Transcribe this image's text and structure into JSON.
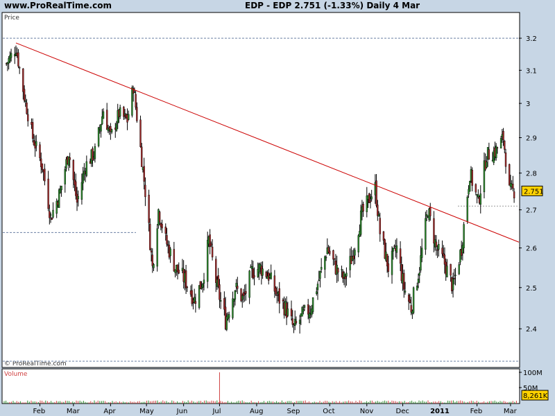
{
  "header": {
    "site": "www.ProRealTime.com",
    "info": "EDP - EDP    2.751 (-1.33%)    Daily  4 Mar"
  },
  "chart_data": [
    {
      "type": "candlestick",
      "title": "EDP - EDP",
      "panel_label": "Price",
      "watermark": "© ProRealTime.com",
      "last_value": "2.751",
      "change": "-1.33%",
      "period": "Daily",
      "date": "4 Mar",
      "y_ticks": [
        "3.2",
        "3.1",
        "3",
        "2.9",
        "2.8",
        "2.7",
        "2.6",
        "2.5",
        "2.4"
      ],
      "ylim": [
        2.34,
        3.25
      ],
      "y_scale": "log",
      "x_labels": [
        "Feb",
        "Mar",
        "Apr",
        "May",
        "Jun",
        "Jul",
        "Aug",
        "Sep",
        "Oct",
        "Nov",
        "Dec",
        "2011",
        "Feb",
        "Mar"
      ],
      "series_close_approx": [
        {
          "x": "2010-01-04",
          "y": 3.12
        },
        {
          "x": "2010-01-12",
          "y": 3.17
        },
        {
          "x": "2010-01-19",
          "y": 3.02
        },
        {
          "x": "2010-01-26",
          "y": 2.9
        },
        {
          "x": "2010-02-03",
          "y": 2.82
        },
        {
          "x": "2010-02-10",
          "y": 2.68
        },
        {
          "x": "2010-02-18",
          "y": 2.75
        },
        {
          "x": "2010-02-25",
          "y": 2.86
        },
        {
          "x": "2010-03-04",
          "y": 2.72
        },
        {
          "x": "2010-03-11",
          "y": 2.82
        },
        {
          "x": "2010-03-19",
          "y": 2.86
        },
        {
          "x": "2010-03-26",
          "y": 2.98
        },
        {
          "x": "2010-04-01",
          "y": 2.9
        },
        {
          "x": "2010-04-08",
          "y": 2.97
        },
        {
          "x": "2010-04-15",
          "y": 2.95
        },
        {
          "x": "2010-04-20",
          "y": 3.05
        },
        {
          "x": "2010-04-23",
          "y": 2.96
        },
        {
          "x": "2010-04-30",
          "y": 2.75
        },
        {
          "x": "2010-05-06",
          "y": 2.55
        },
        {
          "x": "2010-05-11",
          "y": 2.7
        },
        {
          "x": "2010-05-17",
          "y": 2.62
        },
        {
          "x": "2010-05-25",
          "y": 2.55
        },
        {
          "x": "2010-06-02",
          "y": 2.52
        },
        {
          "x": "2010-06-10",
          "y": 2.47
        },
        {
          "x": "2010-06-17",
          "y": 2.52
        },
        {
          "x": "2010-06-22",
          "y": 2.62
        },
        {
          "x": "2010-06-29",
          "y": 2.5
        },
        {
          "x": "2010-07-06",
          "y": 2.42
        },
        {
          "x": "2010-07-14",
          "y": 2.5
        },
        {
          "x": "2010-07-21",
          "y": 2.47
        },
        {
          "x": "2010-07-28",
          "y": 2.54
        },
        {
          "x": "2010-08-04",
          "y": 2.55
        },
        {
          "x": "2010-08-11",
          "y": 2.53
        },
        {
          "x": "2010-08-18",
          "y": 2.48
        },
        {
          "x": "2010-08-25",
          "y": 2.45
        },
        {
          "x": "2010-09-01",
          "y": 2.4
        },
        {
          "x": "2010-09-08",
          "y": 2.43
        },
        {
          "x": "2010-09-15",
          "y": 2.45
        },
        {
          "x": "2010-09-22",
          "y": 2.52
        },
        {
          "x": "2010-09-29",
          "y": 2.6
        },
        {
          "x": "2010-10-06",
          "y": 2.55
        },
        {
          "x": "2010-10-13",
          "y": 2.52
        },
        {
          "x": "2010-10-20",
          "y": 2.58
        },
        {
          "x": "2010-10-27",
          "y": 2.68
        },
        {
          "x": "2010-11-03",
          "y": 2.73
        },
        {
          "x": "2010-11-08",
          "y": 2.76
        },
        {
          "x": "2010-11-12",
          "y": 2.64
        },
        {
          "x": "2010-11-19",
          "y": 2.55
        },
        {
          "x": "2010-11-26",
          "y": 2.6
        },
        {
          "x": "2010-12-02",
          "y": 2.5
        },
        {
          "x": "2010-12-08",
          "y": 2.45
        },
        {
          "x": "2010-12-15",
          "y": 2.55
        },
        {
          "x": "2010-12-22",
          "y": 2.7
        },
        {
          "x": "2010-12-29",
          "y": 2.6
        },
        {
          "x": "2011-01-05",
          "y": 2.56
        },
        {
          "x": "2011-01-12",
          "y": 2.5
        },
        {
          "x": "2011-01-19",
          "y": 2.6
        },
        {
          "x": "2011-01-26",
          "y": 2.8
        },
        {
          "x": "2011-02-02",
          "y": 2.72
        },
        {
          "x": "2011-02-09",
          "y": 2.85
        },
        {
          "x": "2011-02-16",
          "y": 2.86
        },
        {
          "x": "2011-02-23",
          "y": 2.9
        },
        {
          "x": "2011-02-28",
          "y": 2.75
        },
        {
          "x": "2011-03-04",
          "y": 2.751
        }
      ],
      "annotations": [
        {
          "kind": "trendline",
          "color": "#cc0000",
          "from": {
            "x": "2010-01-12",
            "y": 3.185
          },
          "to": {
            "x": "2011-03-08",
            "y": 2.615
          }
        },
        {
          "kind": "hline",
          "y": 3.2
        },
        {
          "kind": "hline",
          "y": 2.64
        },
        {
          "kind": "hline",
          "y": 2.71
        }
      ]
    },
    {
      "type": "bar",
      "panel_label": "Volume",
      "y_ticks": [
        "100M",
        "50M"
      ],
      "last_value": "8,261K",
      "spike": {
        "x": "2010-07-01",
        "value": "100M"
      }
    }
  ]
}
